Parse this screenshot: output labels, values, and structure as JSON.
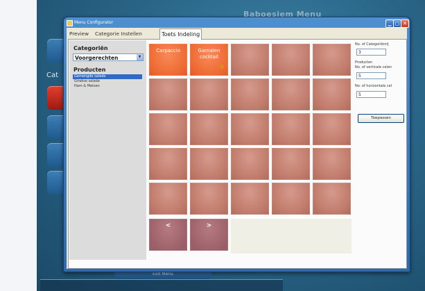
{
  "background_app": {
    "title": "Baboesjem Menu",
    "category_label": "Cat",
    "bottom_button": "Exit Menu"
  },
  "window": {
    "title": "Menu Configurator",
    "controls": [
      "minimize",
      "maximize",
      "close"
    ]
  },
  "tabs": [
    {
      "label": "Preview",
      "active": false
    },
    {
      "label": "Categorie Instellen",
      "active": false
    },
    {
      "label": "Toets Indeling",
      "active": true
    }
  ],
  "left_panel": {
    "categories_label": "Categoriën",
    "category_selected": "Voorgerechten",
    "products_label": "Producten",
    "products": [
      {
        "label": "Gemengde salade",
        "selected": true
      },
      {
        "label": "Griekse salade",
        "selected": false
      },
      {
        "label": "Ham & Meloen",
        "selected": false
      }
    ]
  },
  "grid": {
    "columns": 5,
    "rows": 5,
    "tiles": [
      {
        "label": "Carpaccio",
        "state": "assigned"
      },
      {
        "label": "Garnalen cocktail",
        "state": "assigned"
      },
      {
        "label": "",
        "state": "empty"
      },
      {
        "label": "",
        "state": "empty"
      },
      {
        "label": "",
        "state": "empty"
      },
      {
        "label": "",
        "state": "empty"
      },
      {
        "label": "",
        "state": "empty"
      },
      {
        "label": "",
        "state": "empty"
      },
      {
        "label": "",
        "state": "empty"
      },
      {
        "label": "",
        "state": "empty"
      },
      {
        "label": "",
        "state": "empty"
      },
      {
        "label": "",
        "state": "empty"
      },
      {
        "label": "",
        "state": "empty"
      },
      {
        "label": "",
        "state": "empty"
      },
      {
        "label": "",
        "state": "empty"
      },
      {
        "label": "",
        "state": "empty"
      },
      {
        "label": "",
        "state": "empty"
      },
      {
        "label": "",
        "state": "empty"
      },
      {
        "label": "",
        "state": "empty"
      },
      {
        "label": "",
        "state": "empty"
      },
      {
        "label": "",
        "state": "empty"
      },
      {
        "label": "",
        "state": "empty"
      },
      {
        "label": "",
        "state": "empty"
      },
      {
        "label": "",
        "state": "empty"
      },
      {
        "label": "",
        "state": "empty"
      }
    ],
    "nav_prev": "<",
    "nav_next": ">"
  },
  "right_panel": {
    "categories_count_label": "No. of Categoriënrij",
    "categories_count_value": "3",
    "products_label": "Producten",
    "vertical_label": "No. of verticale celen",
    "vertical_value": "5",
    "horizontal_label": "No. of horizontale cel",
    "horizontal_value": "5",
    "apply_button": "Toepassen"
  },
  "colors": {
    "tile_assigned": "#ee6a33",
    "tile_empty": "#c07a6a",
    "tile_nav": "#9a5e67",
    "selection": "#316ac5",
    "window_frame": "#2d69ad"
  }
}
